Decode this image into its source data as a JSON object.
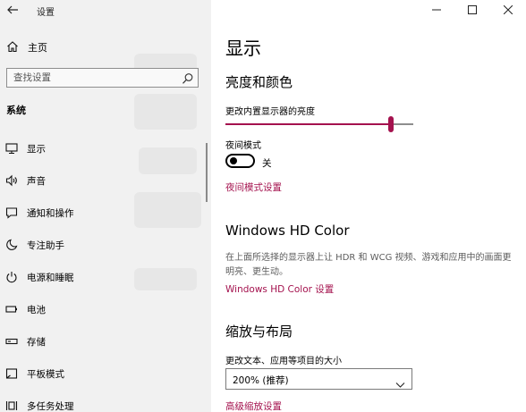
{
  "window": {
    "app_title": "设置",
    "controls": [
      "minimize-icon",
      "maximize-icon",
      "close-icon"
    ]
  },
  "sidebar": {
    "home_label": "主页",
    "search_placeholder": "查找设置",
    "section_heading": "系统",
    "items": [
      {
        "label": "显示",
        "icon": "monitor-icon"
      },
      {
        "label": "声音",
        "icon": "speaker-icon"
      },
      {
        "label": "通知和操作",
        "icon": "notification-icon"
      },
      {
        "label": "专注助手",
        "icon": "moon-icon"
      },
      {
        "label": "电源和睡眠",
        "icon": "power-icon"
      },
      {
        "label": "电池",
        "icon": "battery-icon"
      },
      {
        "label": "存储",
        "icon": "storage-icon"
      },
      {
        "label": "平板模式",
        "icon": "tablet-icon"
      },
      {
        "label": "多任务处理",
        "icon": "multitask-icon"
      }
    ],
    "selected_index": 0
  },
  "main": {
    "title": "显示",
    "brightness": {
      "heading": "亮度和颜色",
      "slider_label": "更改内置显示器的亮度",
      "level": 0.88
    },
    "night_light": {
      "label": "夜间模式",
      "state": "关",
      "settings_link": "夜间模式设置"
    },
    "hd_color": {
      "heading": "Windows HD Color",
      "description": "在上面所选择的显示器上让 HDR 和 WCG 视频、游戏和应用中的画面更明亮、更生动。",
      "link": "Windows HD Color 设置"
    },
    "scale_layout": {
      "heading": "缩放与布局",
      "label": "更改文本、应用等项目的大小",
      "selected_option": "200% (推荐)",
      "advanced_link": "高级缩放设置"
    }
  },
  "colors": {
    "accent": "#a4124e",
    "sidebar_bg": "#f1f1f1"
  }
}
